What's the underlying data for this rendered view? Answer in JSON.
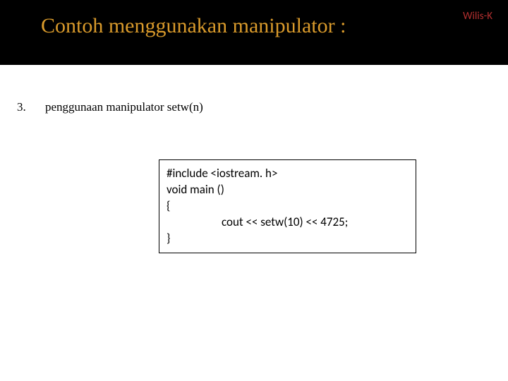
{
  "header": {
    "title": "Contoh menggunakan manipulator :",
    "author": "Wilis-K"
  },
  "item": {
    "number": "3.",
    "text": "penggunaan manipulator setw(n)"
  },
  "code": {
    "line1": "#include <iostream. h>",
    "line2": "void main ()",
    "line3": "{",
    "line4": "cout << setw(10) << 4725;",
    "line5": "}"
  }
}
